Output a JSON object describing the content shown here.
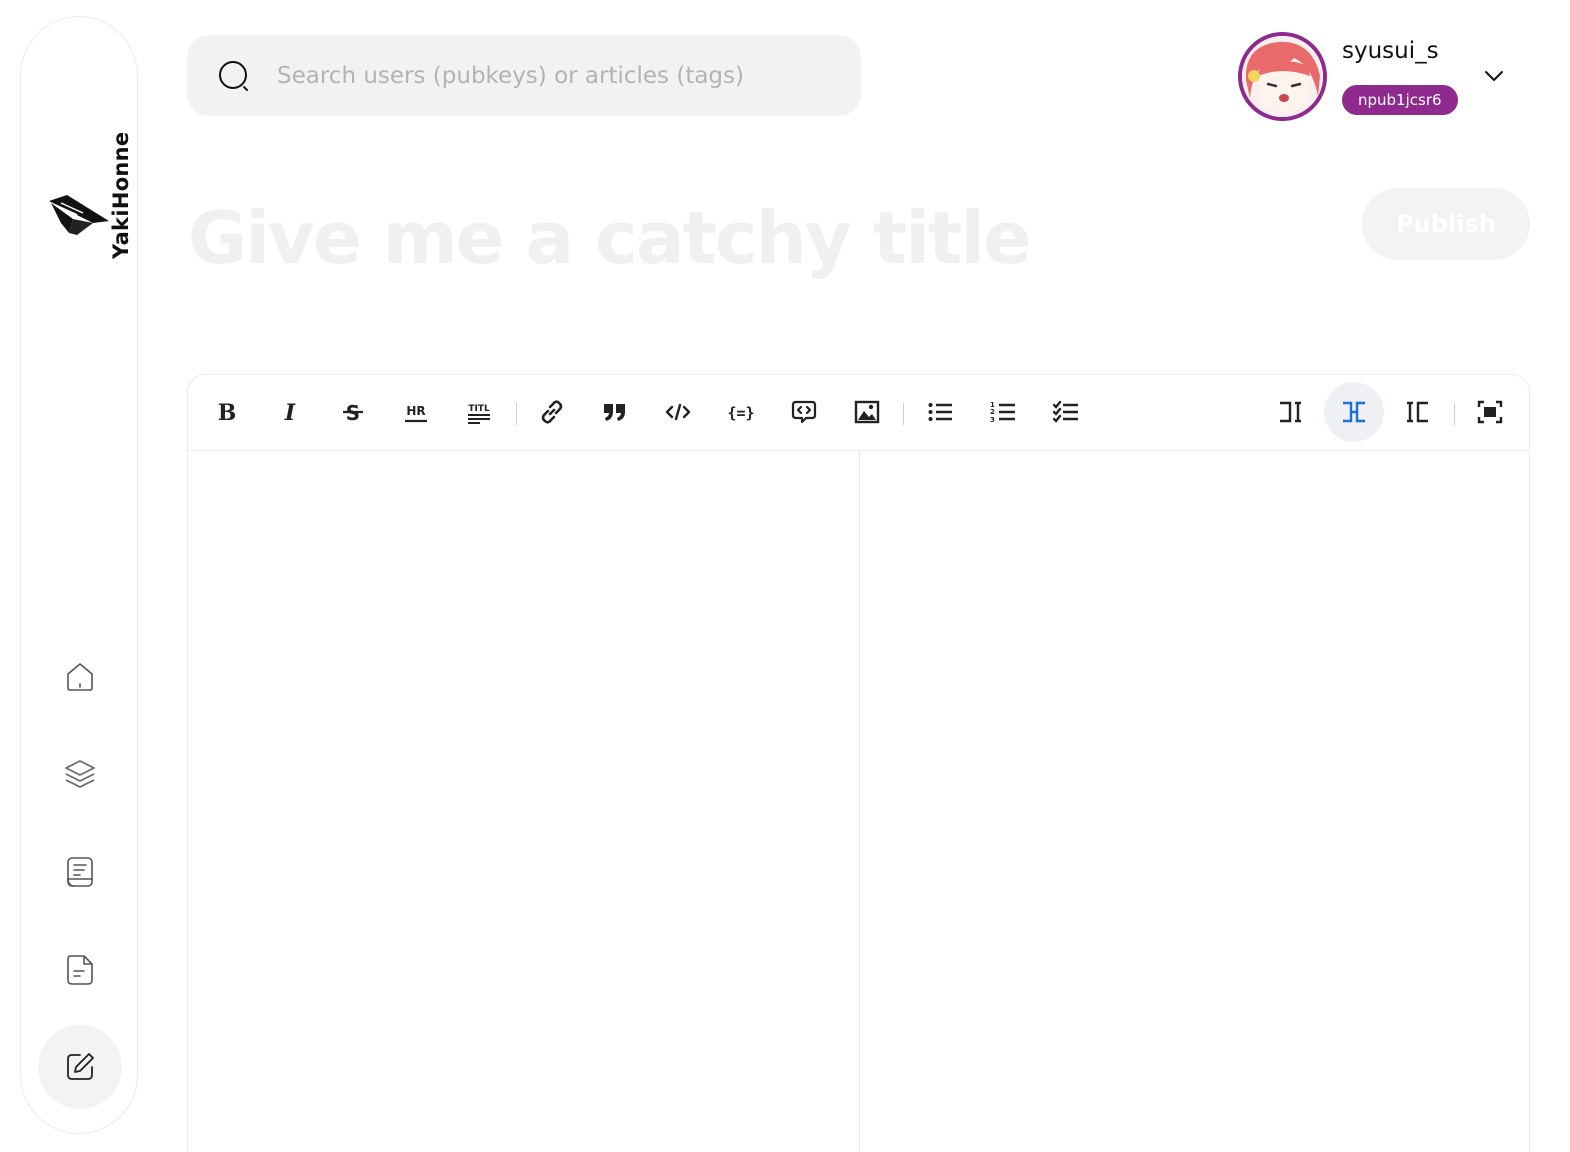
{
  "app": {
    "name": "YakiHonne"
  },
  "sidebar": {
    "items": [
      {
        "name": "home",
        "icon": "home-icon"
      },
      {
        "name": "flows",
        "icon": "layers-icon"
      },
      {
        "name": "articles",
        "icon": "notebook-icon"
      },
      {
        "name": "notes",
        "icon": "document-icon"
      },
      {
        "name": "write",
        "icon": "edit-icon",
        "active": true
      }
    ]
  },
  "search": {
    "placeholder": "Search users (pubkeys) or articles (tags)",
    "value": ""
  },
  "user": {
    "name": "syusui_s",
    "npub": "npub1jcsr6",
    "accent": "#8e2a8e"
  },
  "editor": {
    "title_placeholder": "Give me a catchy title",
    "title_value": "",
    "publish_label": "Publish",
    "content": "",
    "active_view": "split",
    "active_color": "#1e6fd9",
    "toolbar": [
      "bold-icon",
      "italic-icon",
      "strikethrough-icon",
      "horizontal-rule-icon",
      "title-icon",
      "link-icon",
      "quote-icon",
      "code-icon",
      "code-block-icon",
      "comment-icon",
      "image-icon",
      "unordered-list-icon",
      "ordered-list-icon",
      "checked-list-icon",
      "edit-only-icon",
      "split-view-icon",
      "preview-only-icon",
      "fullscreen-icon"
    ]
  }
}
